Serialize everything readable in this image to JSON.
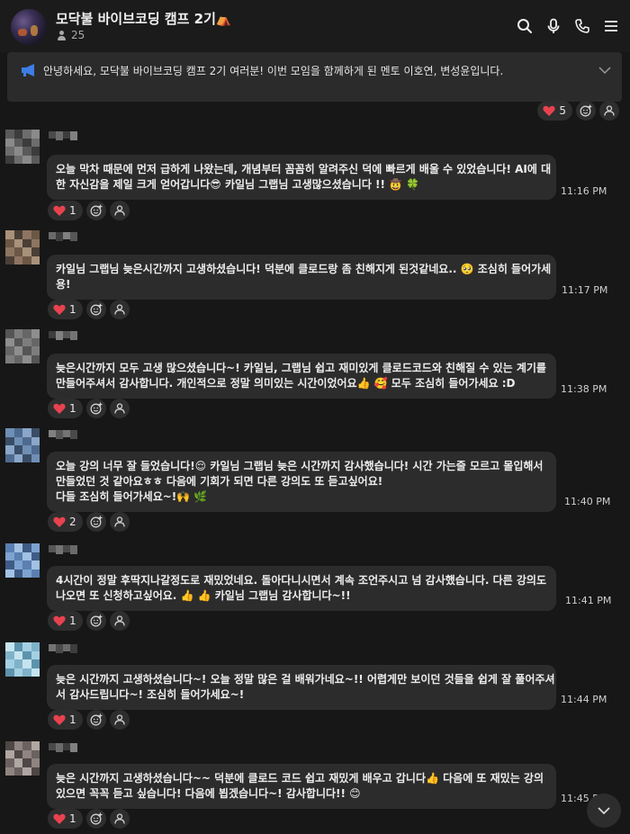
{
  "header": {
    "room_title": "모닥불 바이브코딩 캠프 2기",
    "title_emoji": "⛺",
    "member_count": "25"
  },
  "notice": {
    "text": "안녕하세요, 모닥불 바이브코딩  캠프 2기 여러분!  이번 모임을 함께하게 된 멘토 이호연, 변성윤입니다."
  },
  "top_reactions": {
    "heart_count": "5"
  },
  "messages": [
    {
      "lines": [
        "오늘 막차 때문에 먼저 급하게 나왔는데, 개념부터 꼼꼼히 알려주신 덕에 빠르게 배울 수 있었습니다! AI에 대",
        "한 자신감을 제일 크게 얻어갑니다😎 카일님 그랩님 고생많으셨습니다 !! 🤠 🍀"
      ],
      "time": "11:16 PM",
      "heart_count": "1"
    },
    {
      "lines": [
        "카일님 그랩님 늦은시간까지 고생하셨습니다! 덕분에 클로드랑 좀 친해지게 된것같네요.. 🥺 조심히 들어가세",
        "용!"
      ],
      "time": "11:17 PM",
      "heart_count": "1"
    },
    {
      "lines": [
        "늦은시간까지 모두 고생 많으셨습니다~! 카일님, 그랩님 쉽고 재미있게 클로드코드와 친해질 수 있는 계기를",
        "만들어주셔서 감사합니다. 개인적으로 정말 의미있는 시간이었어요👍 🥰  모두 조심히 들어가세요 :D"
      ],
      "time": "11:38 PM",
      "heart_count": "1"
    },
    {
      "lines": [
        "오늘 강의 너무 잘 들었습니다!😌  카일님 그랩님 늦은 시간까지 감사했습니다! 시간 가는줄 모르고 몰입해서",
        "만들었던 것 같아요ㅎㅎ 다음에 기회가 되면 다른 강의도 또 듣고싶어요!",
        "다들 조심히 들어가세요~!🙌 🌿"
      ],
      "time": "11:40 PM",
      "heart_count": "2"
    },
    {
      "lines": [
        "4시간이 정말 후딱지나갈정도로 재밌었네요. 돌아다니시면서 계속 조언주시고 넘 감사했습니다. 다른 강의도",
        "나오면 또 신청하고싶어요. 👍 👍  카일님 그랩님 감사합니다~!!"
      ],
      "time": "11:41 PM",
      "heart_count": "1"
    },
    {
      "lines": [
        "늦은 시간까지 고생하셨습니다~! 오늘 정말 많은 걸 배워가네요~!! 어렵게만 보이던 것들을 쉽게 잘 풀어주셔",
        "서 감사드립니다~! 조심히 들어가세요~!"
      ],
      "time": "11:44 PM",
      "heart_count": "1"
    },
    {
      "lines": [
        "늦은 시간까지 고생하셨습니다~~ 덕분에 클로드 코드 쉽고 재밌게 배우고 갑니다👍  다음에 또 재밌는 강의",
        "있으면 꼭꼭 듣고 싶습니다! 다음에 뵙겠습니다~! 감사합니다!! 😊"
      ],
      "time": "11:45 PM",
      "heart_count": "1"
    }
  ],
  "icons": {
    "search": "search-icon",
    "microphone": "microphone-icon",
    "call": "phone-icon",
    "menu": "menu-icon",
    "notice": "megaphone-icon",
    "expand": "chevron-down-icon",
    "add_reaction": "add-reaction-icon",
    "reactors": "person-icon",
    "scroll_down": "chevron-down-icon"
  },
  "colors": {
    "background": "#171717",
    "bubble": "#2c2c2c",
    "heart": "#e8424f",
    "notice_accent": "#3d7de5"
  }
}
